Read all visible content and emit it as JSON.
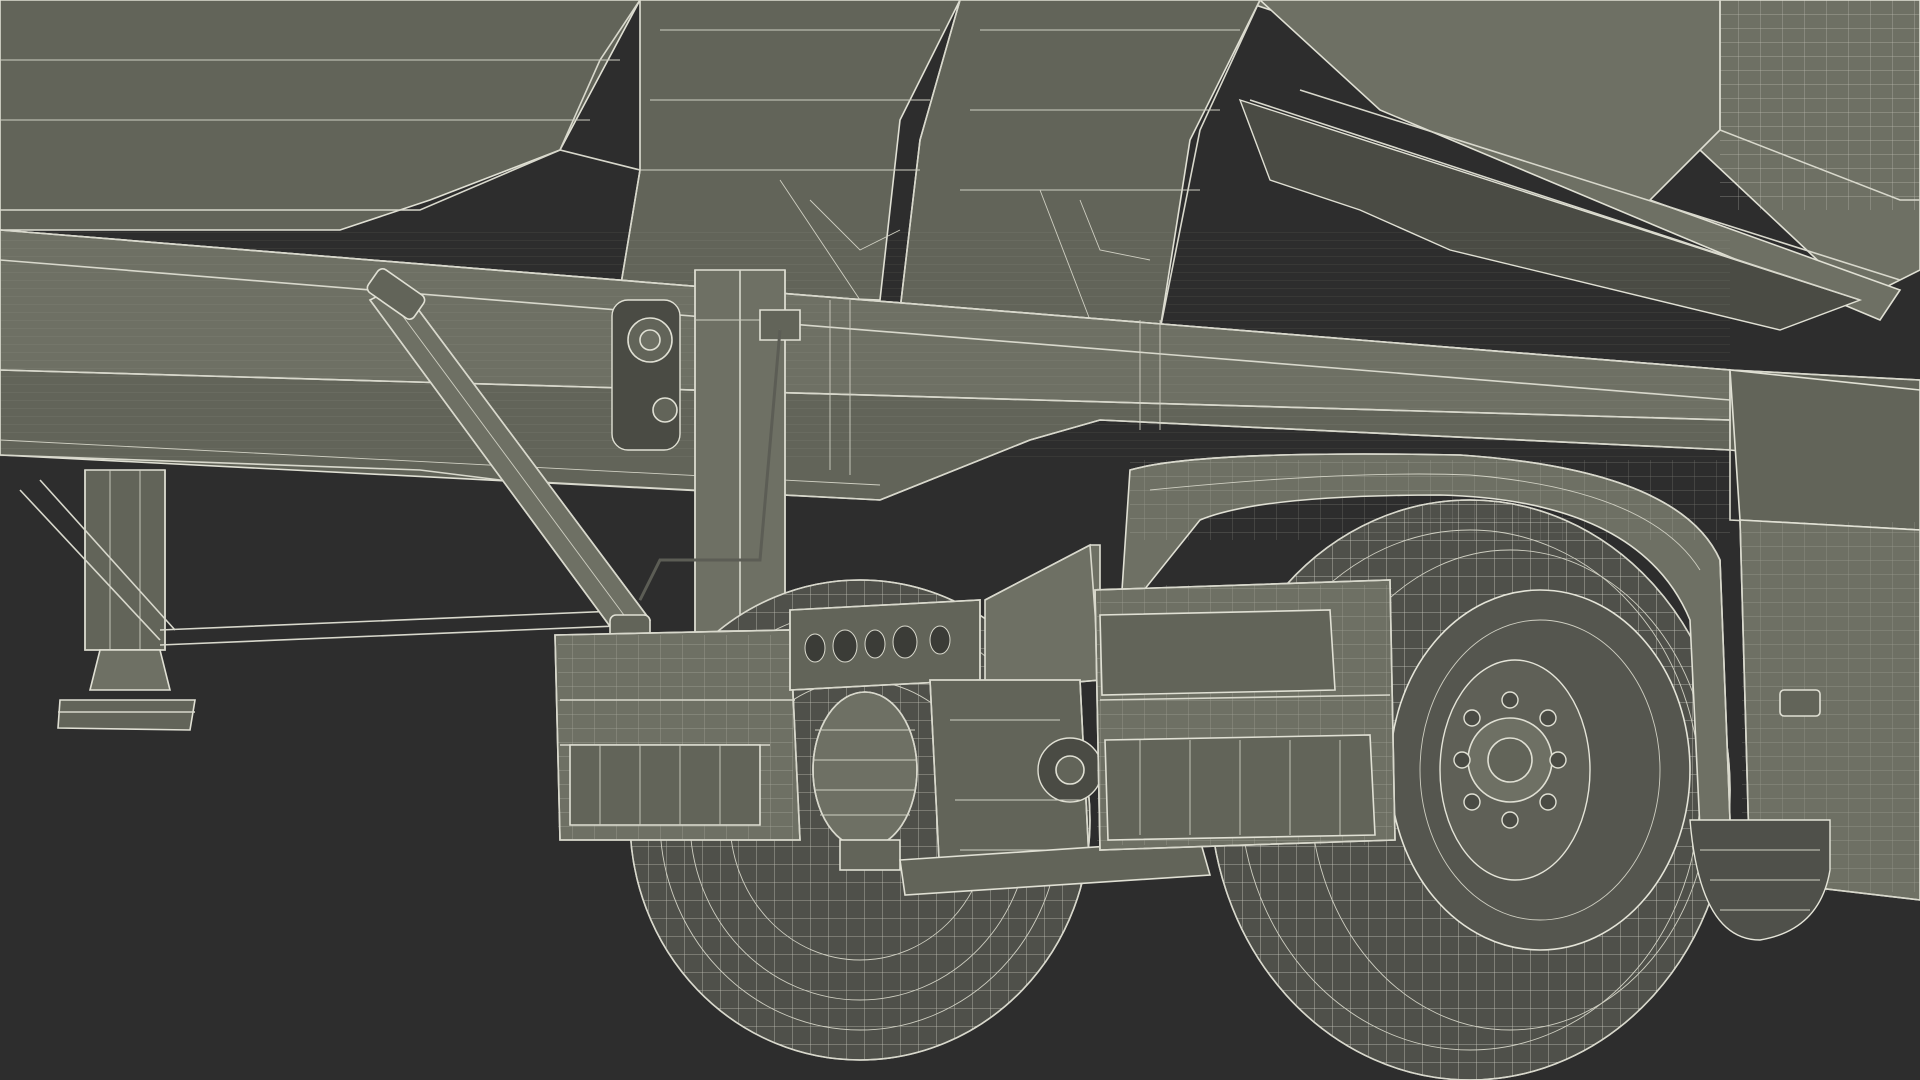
{
  "scene": {
    "subject": "dump-trailer-undercarriage-wireframe",
    "render_style": "wireframe-over-shaded",
    "colors": {
      "background": "#2d2d2d",
      "surface": "#626459",
      "surface_light": "#6e7064",
      "surface_dark": "#4a4b44",
      "wire": "#e0e0d4"
    }
  }
}
